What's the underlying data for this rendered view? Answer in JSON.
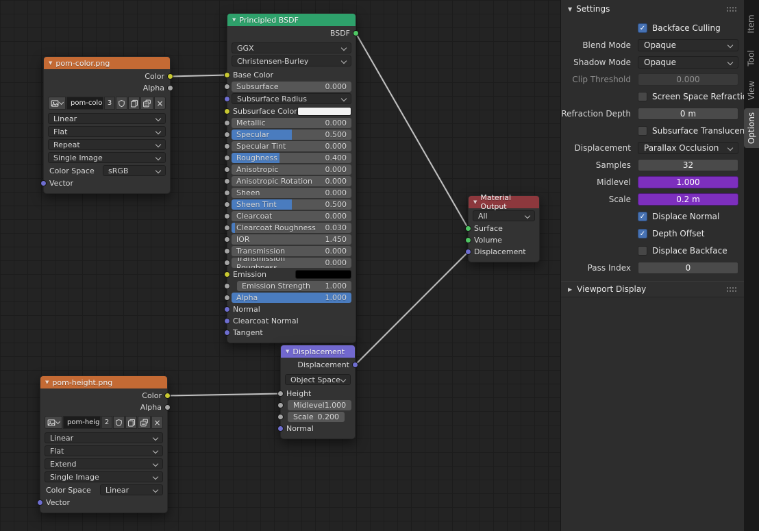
{
  "colors": {
    "header_image_node": "#c46a34",
    "header_shader_node": "#2ea16b",
    "header_output_node": "#8d383d",
    "header_vector_node": "#7168ce",
    "slider_fill_blue": "#4a7cbf",
    "checkbox_blue": "#4772b3",
    "driven_value_purple": "#7d2fbe",
    "socket_yellow": "#c8c832",
    "socket_gray": "#a5a5a5",
    "socket_purple": "#6e6ed0",
    "socket_green": "#4fc764",
    "wire": "#c2c2c2"
  },
  "nodes": {
    "pom_color": {
      "title": "pom-color.png",
      "outputs": [
        {
          "label": "Color",
          "socket": "yellow"
        },
        {
          "label": "Alpha",
          "socket": "gray"
        }
      ],
      "image": {
        "name": "pom-color.png",
        "users": "3"
      },
      "dropdowns": [
        "Linear",
        "Flat",
        "Repeat",
        "Single Image"
      ],
      "color_space_label": "Color Space",
      "color_space": "sRGB",
      "input": "Vector"
    },
    "pom_height": {
      "title": "pom-height.png",
      "outputs": [
        {
          "label": "Color",
          "socket": "yellow"
        },
        {
          "label": "Alpha",
          "socket": "gray"
        }
      ],
      "image": {
        "name": "pom-height...",
        "users": "2"
      },
      "dropdowns": [
        "Linear",
        "Flat",
        "Extend",
        "Single Image"
      ],
      "color_space_label": "Color Space",
      "color_space": "Linear",
      "input": "Vector"
    },
    "principled": {
      "title": "Principled BSDF",
      "output": "BSDF",
      "dropdowns": [
        "GGX",
        "Christensen-Burley"
      ],
      "rows": [
        {
          "type": "prop",
          "label": "Base Color",
          "socket": "yellow"
        },
        {
          "type": "slider",
          "label": "Subsurface",
          "value": "0.000",
          "fill": 0,
          "socket": "gray"
        },
        {
          "type": "dropdown",
          "label": "Subsurface Radius",
          "socket": "purple"
        },
        {
          "type": "color",
          "label": "Subsurface Color",
          "swatch": "#f2f2f2",
          "socket": "yellow"
        },
        {
          "type": "slider",
          "label": "Metallic",
          "value": "0.000",
          "fill": 0,
          "socket": "gray"
        },
        {
          "type": "slider",
          "label": "Specular",
          "value": "0.500",
          "fill": 50,
          "socket": "gray"
        },
        {
          "type": "slider",
          "label": "Specular Tint",
          "value": "0.000",
          "fill": 0,
          "socket": "gray"
        },
        {
          "type": "slider",
          "label": "Roughness",
          "value": "0.400",
          "fill": 40,
          "socket": "gray"
        },
        {
          "type": "slider",
          "label": "Anisotropic",
          "value": "0.000",
          "fill": 0,
          "socket": "gray"
        },
        {
          "type": "slider",
          "label": "Anisotropic Rotation",
          "value": "0.000",
          "fill": 0,
          "socket": "gray"
        },
        {
          "type": "slider",
          "label": "Sheen",
          "value": "0.000",
          "fill": 0,
          "socket": "gray"
        },
        {
          "type": "slider",
          "label": "Sheen Tint",
          "value": "0.500",
          "fill": 50,
          "socket": "gray"
        },
        {
          "type": "slider",
          "label": "Clearcoat",
          "value": "0.000",
          "fill": 0,
          "socket": "gray"
        },
        {
          "type": "slider",
          "label": "Clearcoat Roughness",
          "value": "0.030",
          "fill": 3,
          "socket": "gray"
        },
        {
          "type": "slider",
          "label": "IOR",
          "value": "1.450",
          "fill": 0,
          "socket": "gray"
        },
        {
          "type": "slider",
          "label": "Transmission",
          "value": "0.000",
          "fill": 0,
          "socket": "gray"
        },
        {
          "type": "slider",
          "label": "Transmission Roughness",
          "value": "0.000",
          "fill": 0,
          "socket": "gray"
        },
        {
          "type": "color",
          "label": "Emission",
          "swatch": "#000000",
          "socket": "yellow"
        },
        {
          "type": "slider",
          "label": "Emission Strength",
          "value": "1.000",
          "fill": 0,
          "socket": "gray",
          "indent": true
        },
        {
          "type": "slider",
          "label": "Alpha",
          "value": "1.000",
          "fill": 100,
          "socket": "gray"
        },
        {
          "type": "prop",
          "label": "Normal",
          "socket": "purple"
        },
        {
          "type": "prop",
          "label": "Clearcoat Normal",
          "socket": "purple"
        },
        {
          "type": "prop",
          "label": "Tangent",
          "socket": "purple"
        }
      ]
    },
    "material_output": {
      "title": "Material Output",
      "target": "All",
      "inputs": [
        "Surface",
        "Volume",
        "Displacement"
      ]
    },
    "displacement": {
      "title": "Displacement",
      "output": "Displacement",
      "space": "Object Space",
      "rows": [
        {
          "type": "prop",
          "label": "Height",
          "socket": "gray"
        },
        {
          "type": "pair",
          "label": "Midlevel",
          "value": "1.000",
          "socket": "gray"
        },
        {
          "type": "pair",
          "label": "Scale",
          "value": "0.200",
          "socket": "gray"
        },
        {
          "type": "prop",
          "label": "Normal",
          "socket": "purple"
        }
      ]
    }
  },
  "panel": {
    "header": "Settings",
    "rows": [
      {
        "type": "checkbox",
        "label": "Backface Culling",
        "checked": true
      },
      {
        "type": "dropdown",
        "label": "Blend Mode",
        "value": "Opaque"
      },
      {
        "type": "dropdown",
        "label": "Shadow Mode",
        "value": "Opaque"
      },
      {
        "type": "field",
        "label": "Clip Threshold",
        "value": "0.000",
        "disabled": true
      },
      {
        "type": "checkbox",
        "label": "Screen Space Refraction",
        "checked": false
      },
      {
        "type": "field",
        "label": "Refraction Depth",
        "value": "0 m"
      },
      {
        "type": "checkbox",
        "label": "Subsurface Translucency",
        "checked": false
      },
      {
        "type": "dropdown",
        "label": "Displacement",
        "value": "Parallax Occlusion"
      },
      {
        "type": "field",
        "label": "Samples",
        "value": "32"
      },
      {
        "type": "field",
        "label": "Midlevel",
        "value": "1.000",
        "accent": "purple"
      },
      {
        "type": "field",
        "label": "Scale",
        "value": "0.2 m",
        "accent": "purple"
      },
      {
        "type": "checkbox",
        "label": "Displace Normal",
        "checked": true
      },
      {
        "type": "checkbox",
        "label": "Depth Offset",
        "checked": true
      },
      {
        "type": "checkbox",
        "label": "Displace Backface",
        "checked": false
      },
      {
        "type": "field",
        "label": "Pass Index",
        "value": "0"
      }
    ],
    "viewport_display": "Viewport Display",
    "tabs": [
      "Item",
      "Tool",
      "View",
      "Options"
    ],
    "active_tab": "Options"
  },
  "links": [
    {
      "from": "pc-color-out",
      "to": "pbsdf-in-0"
    },
    {
      "from": "pbsdf-out",
      "to": "mo-in-0"
    },
    {
      "from": "disp-out",
      "to": "mo-in-2"
    },
    {
      "from": "ph-color-out",
      "to": "disp-in-0"
    }
  ]
}
